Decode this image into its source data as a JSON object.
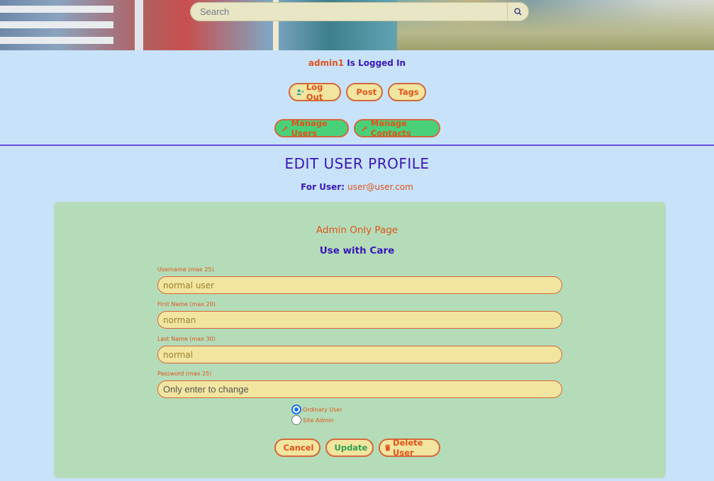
{
  "search": {
    "placeholder": "Search",
    "icon": "search-icon"
  },
  "session": {
    "username": "admin1",
    "suffix": " Is Logged In"
  },
  "nav": {
    "logout_label": "Log Out",
    "post_label": "Post",
    "tags_label": "Tags",
    "manage_users_label": "Manage Users",
    "manage_contacts_label": "Manage Contacts"
  },
  "page": {
    "title": "EDIT USER PROFILE",
    "for_user_prefix": "For User: ",
    "for_user_email": "user@user.com",
    "admin_notice": "Admin Only Page",
    "care_notice": "Use with Care"
  },
  "form": {
    "username": {
      "label": "Username (max 25)",
      "value": "normal user"
    },
    "first_name": {
      "label": "First Name (max 20)",
      "value": "norman"
    },
    "last_name": {
      "label": "Last Name (max 30)",
      "value": "normal"
    },
    "password": {
      "label": "Password (max 25)",
      "placeholder": "Only enter to change"
    },
    "role_options": [
      {
        "label": "Ordinary User",
        "selected": true
      },
      {
        "label": "Site Admin",
        "selected": false
      }
    ]
  },
  "actions": {
    "cancel_label": "Cancel",
    "update_label": "Update",
    "delete_label": "Delete User"
  },
  "colors": {
    "accent_orange": "#e0531c",
    "accent_purple": "#3a17b5",
    "page_bg": "#c8e2f9",
    "panel_bg": "#b5dcb8",
    "pill_bg": "#f1e5a0",
    "green_button": "#49d17a"
  }
}
